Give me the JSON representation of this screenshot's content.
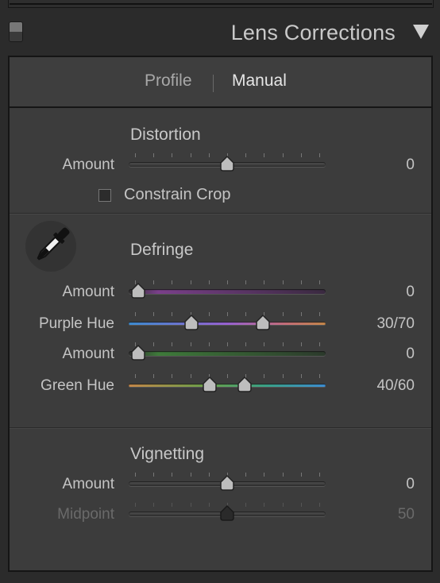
{
  "header": {
    "title": "Lens Corrections"
  },
  "tabs": [
    {
      "label": "Profile",
      "active": false
    },
    {
      "label": "Manual",
      "active": true
    }
  ],
  "distortion": {
    "title": "Distortion",
    "amount": {
      "label": "Amount",
      "value": "0",
      "level": 0.5
    },
    "constrain_crop": {
      "label": "Constrain Crop",
      "checked": false
    }
  },
  "defringe": {
    "title": "Defringe",
    "tool_icon": "eyedropper-icon",
    "purple_amount": {
      "label": "Amount",
      "value": "0",
      "level": 0.0
    },
    "purple_hue": {
      "label": "Purple Hue",
      "value": "30/70",
      "low": 0.3,
      "high": 0.7
    },
    "green_amount": {
      "label": "Amount",
      "value": "0",
      "level": 0.0
    },
    "green_hue": {
      "label": "Green Hue",
      "value": "40/60",
      "low": 0.4,
      "high": 0.6
    }
  },
  "vignetting": {
    "title": "Vignetting",
    "amount": {
      "label": "Amount",
      "value": "0",
      "level": 0.5
    },
    "midpoint": {
      "label": "Midpoint",
      "value": "50",
      "level": 0.5,
      "disabled": true
    }
  },
  "colors": {
    "panel_bg": "#3c3c3c",
    "purple_track": "#7a3f8a",
    "green_track": "#3e7a3a",
    "hue_blue": "#3d8fd6",
    "hue_purple": "#9b63d6",
    "hue_pink": "#c9707a",
    "hue_orange": "#c98a4a",
    "hue_green": "#6aa44a"
  }
}
